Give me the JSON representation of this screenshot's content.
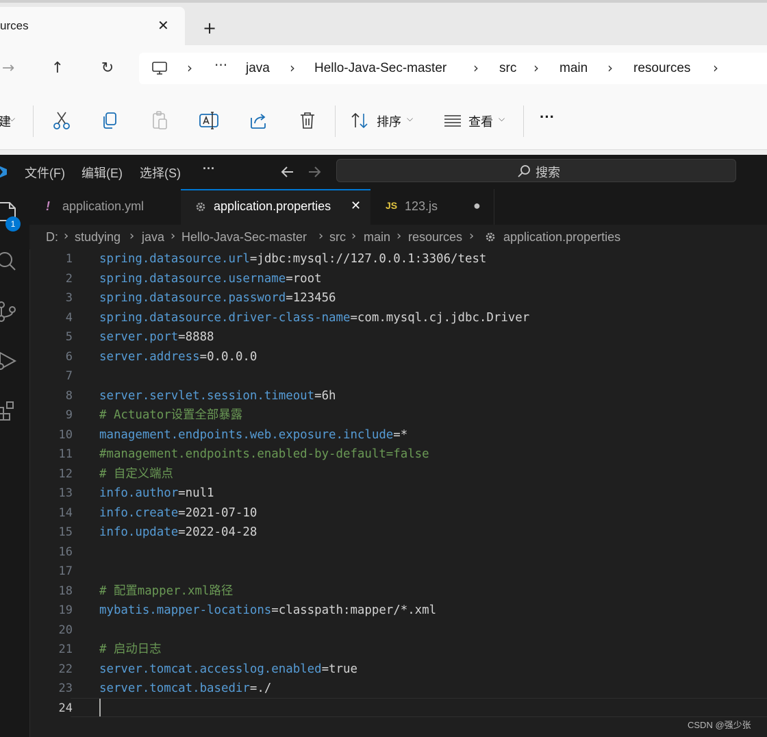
{
  "explorer": {
    "tab_title": "urces",
    "tab_close": "✕",
    "tab_new": "+",
    "nav": {
      "back": "→",
      "up": "↑",
      "refresh": "↻",
      "more": "···"
    },
    "breadcrumbs": [
      "java",
      "Hello-Java-Sec-master",
      "src",
      "main",
      "resources"
    ],
    "toolbar": {
      "new_label_fragment": "建",
      "sort_label": "排序",
      "view_label": "查看",
      "more": "···"
    }
  },
  "vscode": {
    "menu": [
      "文件(F)",
      "编辑(E)",
      "选择(S)"
    ],
    "menu_more": "···",
    "search_label": "搜索",
    "explorer_badge": "1",
    "tabs": [
      {
        "label": "application.yml",
        "icon": "!"
      },
      {
        "label": "application.properties",
        "icon": "gear-icon",
        "close": "✕"
      },
      {
        "label": "123.js",
        "icon": "JS",
        "modified": "●"
      }
    ],
    "breadcrumbs": [
      "D:",
      "studying",
      "java",
      "Hello-Java-Sec-master",
      "src",
      "main",
      "resources",
      "application.properties"
    ],
    "lines": [
      {
        "n": "1",
        "key": "spring.datasource.url",
        "val": "=jdbc:mysql://127.0.0.1:3306/test"
      },
      {
        "n": "2",
        "key": "spring.datasource.username",
        "val": "=root"
      },
      {
        "n": "3",
        "key": "spring.datasource.password",
        "val": "=123456"
      },
      {
        "n": "4",
        "key": "spring.datasource.driver-class-name",
        "val": "=com.mysql.cj.jdbc.Driver"
      },
      {
        "n": "5",
        "key": "server.port",
        "val": "=8888"
      },
      {
        "n": "6",
        "key": "server.address",
        "val": "=0.0.0.0"
      },
      {
        "n": "7"
      },
      {
        "n": "8",
        "key": "server.servlet.session.timeout",
        "val": "=6h"
      },
      {
        "n": "9",
        "comment": "# Actuator设置全部暴露"
      },
      {
        "n": "10",
        "key": "management.endpoints.web.exposure.include",
        "val": "=*"
      },
      {
        "n": "11",
        "comment": "#management.endpoints.enabled-by-default=false"
      },
      {
        "n": "12",
        "comment": "# 自定义端点"
      },
      {
        "n": "13",
        "key": "info.author",
        "val": "=nul1"
      },
      {
        "n": "14",
        "key": "info.create",
        "val": "=2021-07-10"
      },
      {
        "n": "15",
        "key": "info.update",
        "val": "=2022-04-28"
      },
      {
        "n": "16"
      },
      {
        "n": "17"
      },
      {
        "n": "18",
        "comment": "# 配置mapper.xml路径"
      },
      {
        "n": "19",
        "key": "mybatis.mapper-locations",
        "val": "=classpath:mapper/*.xml"
      },
      {
        "n": "20"
      },
      {
        "n": "21",
        "comment": "# 启动日志"
      },
      {
        "n": "22",
        "key": "server.tomcat.accesslog.enabled",
        "val": "=true"
      },
      {
        "n": "23",
        "key": "server.tomcat.basedir",
        "val": "=./"
      },
      {
        "n": "24"
      }
    ]
  },
  "watermark": "CSDN @强少张"
}
